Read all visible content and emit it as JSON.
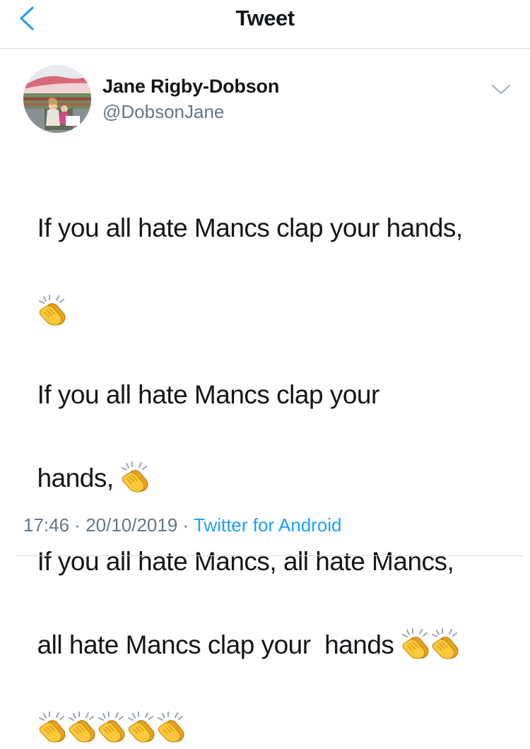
{
  "header": {
    "title": "Tweet",
    "back_icon": "chevron-left-icon",
    "accent_color": "#1da1f2"
  },
  "author": {
    "name": "Jane Rigby-Dobson",
    "handle": "@DobsonJane",
    "avatar_icon": "profile-photo",
    "menu_icon": "chevron-down-icon"
  },
  "tweet": {
    "lines": [
      {
        "text": "If you all hate Mancs clap your hands,",
        "claps_after_break": 1
      },
      {
        "text": "If you all hate Mancs clap your",
        "claps_after_break": 0
      },
      {
        "text": "hands, ",
        "claps_inline": 1
      },
      {
        "text": "If you all hate Mancs, all hate Mancs,",
        "claps_after_break": 0
      },
      {
        "text": "all hate Mancs clap your  hands ",
        "claps_inline": 2
      },
      {
        "text": "",
        "claps_inline": 5
      }
    ],
    "emoji": "clapping-hands"
  },
  "meta": {
    "time": "17:46",
    "separator": " · ",
    "date": "20/10/2019",
    "source": "Twitter for Android"
  }
}
